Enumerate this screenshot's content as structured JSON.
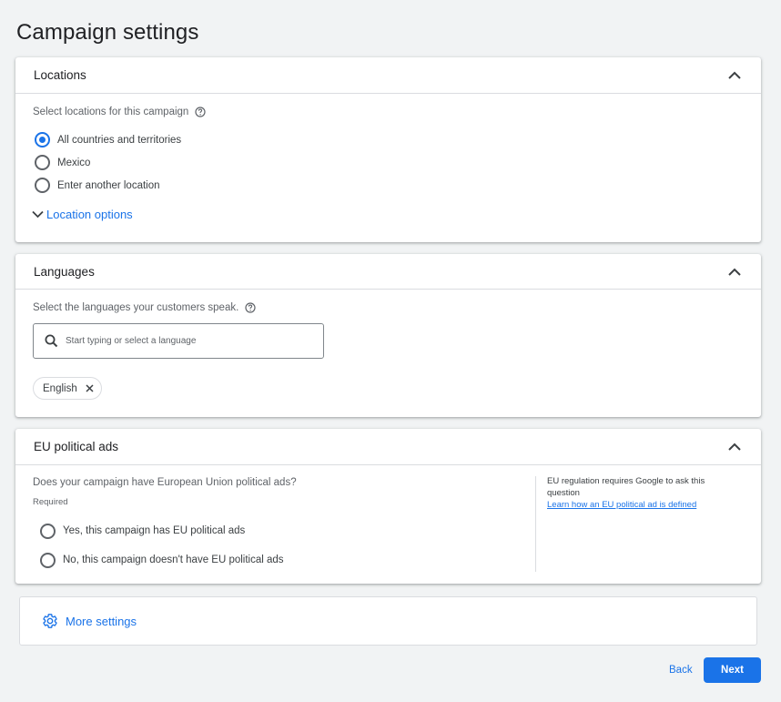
{
  "page": {
    "title": "Campaign settings"
  },
  "colors": {
    "accent": "#1a73e8",
    "background": "#f1f3f4",
    "card": "#ffffff"
  },
  "locations": {
    "title": "Locations",
    "prompt": "Select locations for this campaign",
    "options": [
      {
        "label": "All countries and territories",
        "selected": true
      },
      {
        "label": "Mexico",
        "selected": false
      },
      {
        "label": "Enter another location",
        "selected": false
      }
    ],
    "options_link": "Location options"
  },
  "languages": {
    "title": "Languages",
    "prompt": "Select the languages your customers speak.",
    "search_placeholder": "Start typing or select a language",
    "chips": [
      "English"
    ]
  },
  "eu_political": {
    "title": "EU political ads",
    "question": "Does your campaign have European Union political ads?",
    "required_label": "Required",
    "options": [
      {
        "label": "Yes, this campaign has EU political ads",
        "selected": false
      },
      {
        "label": "No, this campaign doesn't have EU political ads",
        "selected": false
      }
    ],
    "note": "EU regulation requires Google to ask this question",
    "note_link": "Learn how an EU political ad is defined"
  },
  "more_settings": {
    "label": "More settings"
  },
  "footer": {
    "back_label": "Back",
    "next_label": "Next"
  },
  "icons": {
    "collapse": "chevron-up-icon",
    "help": "help-circle-icon",
    "expand": "chevron-down-icon",
    "search": "search-icon",
    "remove": "close-icon",
    "settings": "gear-icon"
  }
}
